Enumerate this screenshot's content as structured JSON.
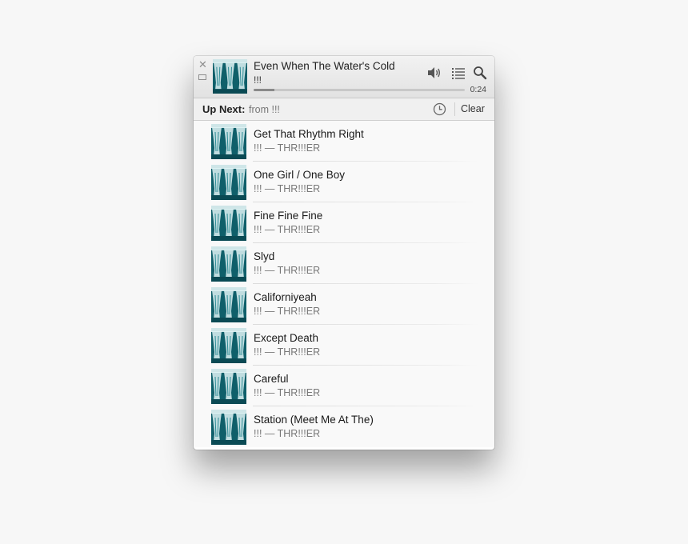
{
  "now_playing": {
    "title": "Even When The Water's Cold",
    "artist": "!!!",
    "time": "0:24",
    "progress": 0.1
  },
  "icons": {
    "close": "close-icon",
    "minimize": "minimize-icon",
    "volume": "speaker-icon",
    "queue": "list-icon",
    "search": "search-icon",
    "history": "clock-icon"
  },
  "up_next": {
    "label": "Up Next:",
    "source": "from !!!",
    "clear_label": "Clear"
  },
  "queue": [
    {
      "title": "Get That Rhythm Right",
      "subtitle": "!!! — THR!!!ER"
    },
    {
      "title": "One Girl / One Boy",
      "subtitle": "!!! — THR!!!ER"
    },
    {
      "title": "Fine Fine Fine",
      "subtitle": "!!! — THR!!!ER"
    },
    {
      "title": "Slyd",
      "subtitle": "!!! — THR!!!ER"
    },
    {
      "title": "Californiyeah",
      "subtitle": "!!! — THR!!!ER"
    },
    {
      "title": "Except Death",
      "subtitle": "!!! — THR!!!ER"
    },
    {
      "title": "Careful",
      "subtitle": "!!! — THR!!!ER"
    },
    {
      "title": "Station (Meet Me At The)",
      "subtitle": "!!! — THR!!!ER"
    }
  ],
  "colors": {
    "album_bg": "#0f5f6a",
    "album_figure": "#dff3f4"
  }
}
